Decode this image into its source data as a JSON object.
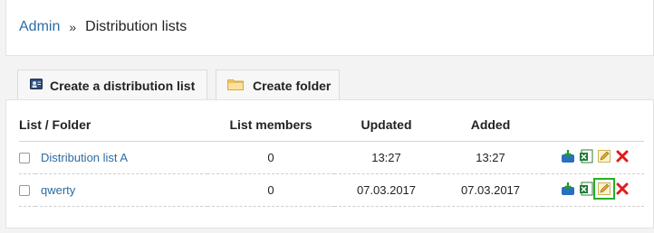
{
  "breadcrumb": {
    "root": "Admin",
    "separator": "»",
    "current": "Distribution lists"
  },
  "toolbar": {
    "create_list": {
      "label": "Create a distribution list",
      "icon": "contact-card-icon"
    },
    "create_folder": {
      "label": "Create folder",
      "icon": "folder-icon"
    }
  },
  "table": {
    "headers": [
      "List / Folder",
      "List members",
      "Updated",
      "Added"
    ],
    "rows": [
      {
        "name": "Distribution list A",
        "members": "0",
        "updated": "13:27",
        "added": "13:27"
      },
      {
        "name": "qwerty",
        "members": "0",
        "updated": "07.03.2017",
        "added": "07.03.2017"
      }
    ],
    "row_actions": [
      "import-icon",
      "excel-export-icon",
      "edit-icon",
      "delete-icon"
    ]
  },
  "colors": {
    "link": "#2d6ca2",
    "delete": "#e11b1b",
    "highlight": "#26b026"
  }
}
